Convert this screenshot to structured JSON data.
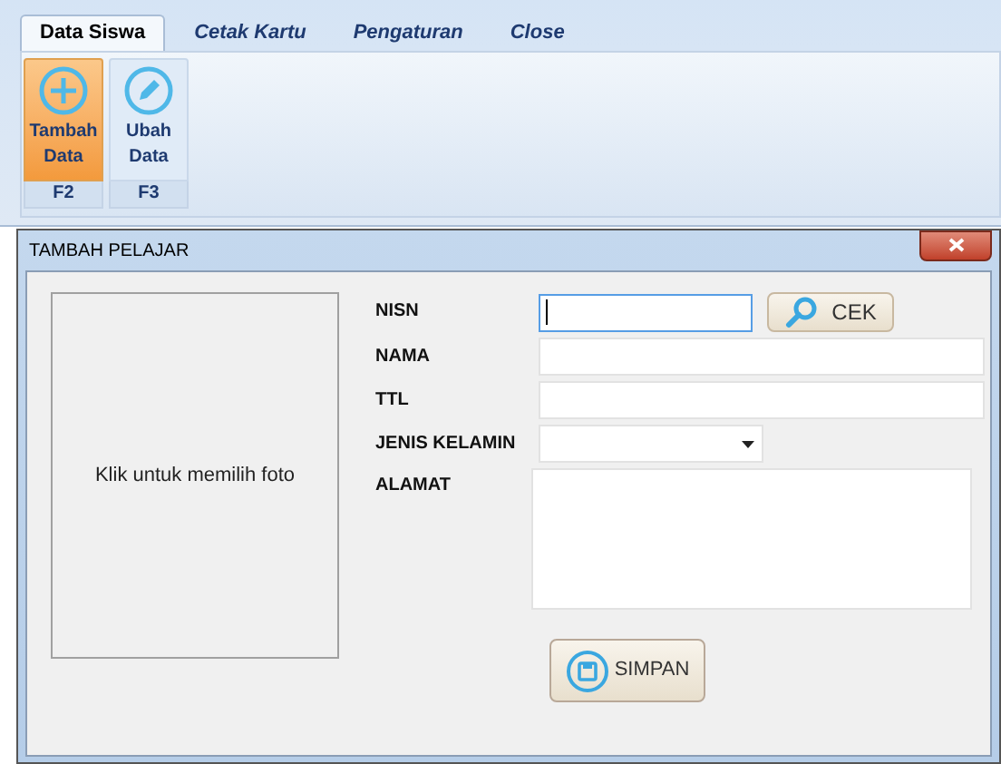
{
  "tabs": [
    {
      "label": "Data Siswa",
      "selected": true
    },
    {
      "label": "Cetak Kartu",
      "selected": false
    },
    {
      "label": "Pengaturan",
      "selected": false
    },
    {
      "label": "Close",
      "selected": false
    }
  ],
  "ribbon_buttons": [
    {
      "kind": "add",
      "label": "Tambah Data",
      "key": "F2",
      "selected": true
    },
    {
      "kind": "edit",
      "label": "Ubah Data",
      "key": "F3",
      "selected": false
    }
  ],
  "dialog": {
    "title": "TAMBAH PELAJAR",
    "photo_placeholder": "Klik untuk memilih foto",
    "fields": [
      {
        "kind": "text_with_button",
        "label": "NISN",
        "focused": true,
        "button": "CEK"
      },
      {
        "kind": "text",
        "label": "NAMA",
        "focused": false
      },
      {
        "kind": "text",
        "label": "TTL",
        "focused": false
      },
      {
        "kind": "dropdown",
        "label": "JENIS KELAMIN",
        "focused": false
      },
      {
        "kind": "textarea",
        "label": "ALAMAT",
        "focused": false
      }
    ],
    "save_button": "SIMPAN"
  }
}
